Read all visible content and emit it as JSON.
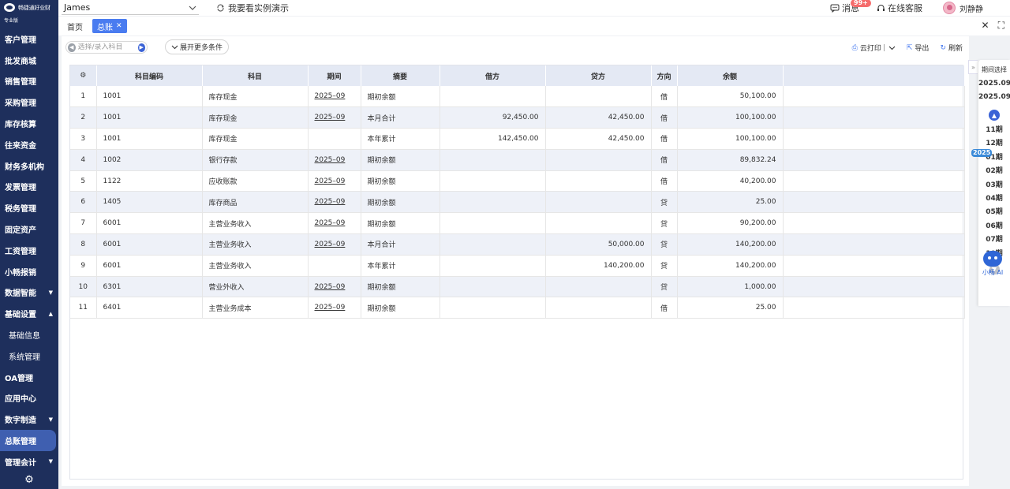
{
  "app": {
    "logo_name": "畅捷通好业财",
    "edition": "专业版"
  },
  "sidebar": {
    "items": [
      {
        "label": "客户管理",
        "caret": ""
      },
      {
        "label": "批发商城",
        "caret": ""
      },
      {
        "label": "销售管理",
        "caret": ""
      },
      {
        "label": "采购管理",
        "caret": ""
      },
      {
        "label": "库存核算",
        "caret": ""
      },
      {
        "label": "往来资金",
        "caret": ""
      },
      {
        "label": "财务多机构",
        "caret": ""
      },
      {
        "label": "发票管理",
        "caret": ""
      },
      {
        "label": "税务管理",
        "caret": ""
      },
      {
        "label": "固定资产",
        "caret": ""
      },
      {
        "label": "工资管理",
        "caret": ""
      },
      {
        "label": "小畅报销",
        "caret": ""
      },
      {
        "label": "数据智能",
        "caret": "▼"
      },
      {
        "label": "基础设置",
        "caret": "▲"
      },
      {
        "label": "基础信息",
        "caret": ""
      },
      {
        "label": "系统管理",
        "caret": ""
      },
      {
        "label": "OA管理",
        "caret": ""
      },
      {
        "label": "应用中心",
        "caret": ""
      },
      {
        "label": "数字制造",
        "caret": "▼"
      },
      {
        "label": "总账管理",
        "caret": ""
      },
      {
        "label": "管理会计",
        "caret": "▼"
      }
    ]
  },
  "topbar": {
    "company": "James",
    "demo_link": "我要看实例演示",
    "messages_label": "消息",
    "messages_badge": "99+",
    "service_label": "在线客服",
    "user_name": "刘静静"
  },
  "tabs": {
    "home": "首页",
    "active": "总账"
  },
  "toolbar": {
    "subject_placeholder": "选择/录入科目",
    "more_conditions": "展开更多条件",
    "cloud_print": "云打印",
    "export": "导出",
    "refresh": "刷新"
  },
  "table": {
    "headers": [
      "科目编码",
      "科目",
      "期间",
      "摘要",
      "借方",
      "贷方",
      "方向",
      "余额"
    ],
    "rows": [
      {
        "no": "1",
        "code": "1001",
        "subject": "库存现金",
        "period": "2025–09",
        "summary": "期初余额",
        "debit": "",
        "credit": "",
        "dir": "借",
        "balance": "50,100.00"
      },
      {
        "no": "2",
        "code": "1001",
        "subject": "库存现金",
        "period": "2025–09",
        "summary": "本月合计",
        "debit": "92,450.00",
        "credit": "42,450.00",
        "dir": "借",
        "balance": "100,100.00"
      },
      {
        "no": "3",
        "code": "1001",
        "subject": "库存现金",
        "period": "",
        "summary": "本年累计",
        "debit": "142,450.00",
        "credit": "42,450.00",
        "dir": "借",
        "balance": "100,100.00"
      },
      {
        "no": "4",
        "code": "1002",
        "subject": "银行存款",
        "period": "2025–09",
        "summary": "期初余额",
        "debit": "",
        "credit": "",
        "dir": "借",
        "balance": "89,832.24"
      },
      {
        "no": "5",
        "code": "1122",
        "subject": "应收账款",
        "period": "2025–09",
        "summary": "期初余额",
        "debit": "",
        "credit": "",
        "dir": "借",
        "balance": "40,200.00"
      },
      {
        "no": "6",
        "code": "1405",
        "subject": "库存商品",
        "period": "2025–09",
        "summary": "期初余额",
        "debit": "",
        "credit": "",
        "dir": "贷",
        "balance": "25.00"
      },
      {
        "no": "7",
        "code": "6001",
        "subject": "主营业务收入",
        "period": "2025–09",
        "summary": "期初余额",
        "debit": "",
        "credit": "",
        "dir": "贷",
        "balance": "90,200.00"
      },
      {
        "no": "8",
        "code": "6001",
        "subject": "主营业务收入",
        "period": "2025–09",
        "summary": "本月合计",
        "debit": "",
        "credit": "50,000.00",
        "dir": "贷",
        "balance": "140,200.00"
      },
      {
        "no": "9",
        "code": "6001",
        "subject": "主营业务收入",
        "period": "",
        "summary": "本年累计",
        "debit": "",
        "credit": "140,200.00",
        "dir": "贷",
        "balance": "140,200.00"
      },
      {
        "no": "10",
        "code": "6301",
        "subject": "营业外收入",
        "period": "2025–09",
        "summary": "期初余额",
        "debit": "",
        "credit": "",
        "dir": "贷",
        "balance": "1,000.00"
      },
      {
        "no": "11",
        "code": "6401",
        "subject": "主营业务成本",
        "period": "2025–09",
        "summary": "期初余额",
        "debit": "",
        "credit": "",
        "dir": "借",
        "balance": "25.00"
      }
    ]
  },
  "period_panel": {
    "title": "期间选择",
    "start": "2025.09",
    "end": "2025.09",
    "year_tag": "2025",
    "periods": [
      "11期",
      "12期",
      "01期",
      "02期",
      "03期",
      "04期",
      "05期",
      "06期",
      "07期",
      "10期"
    ],
    "ai_label": "小畅 AI"
  }
}
